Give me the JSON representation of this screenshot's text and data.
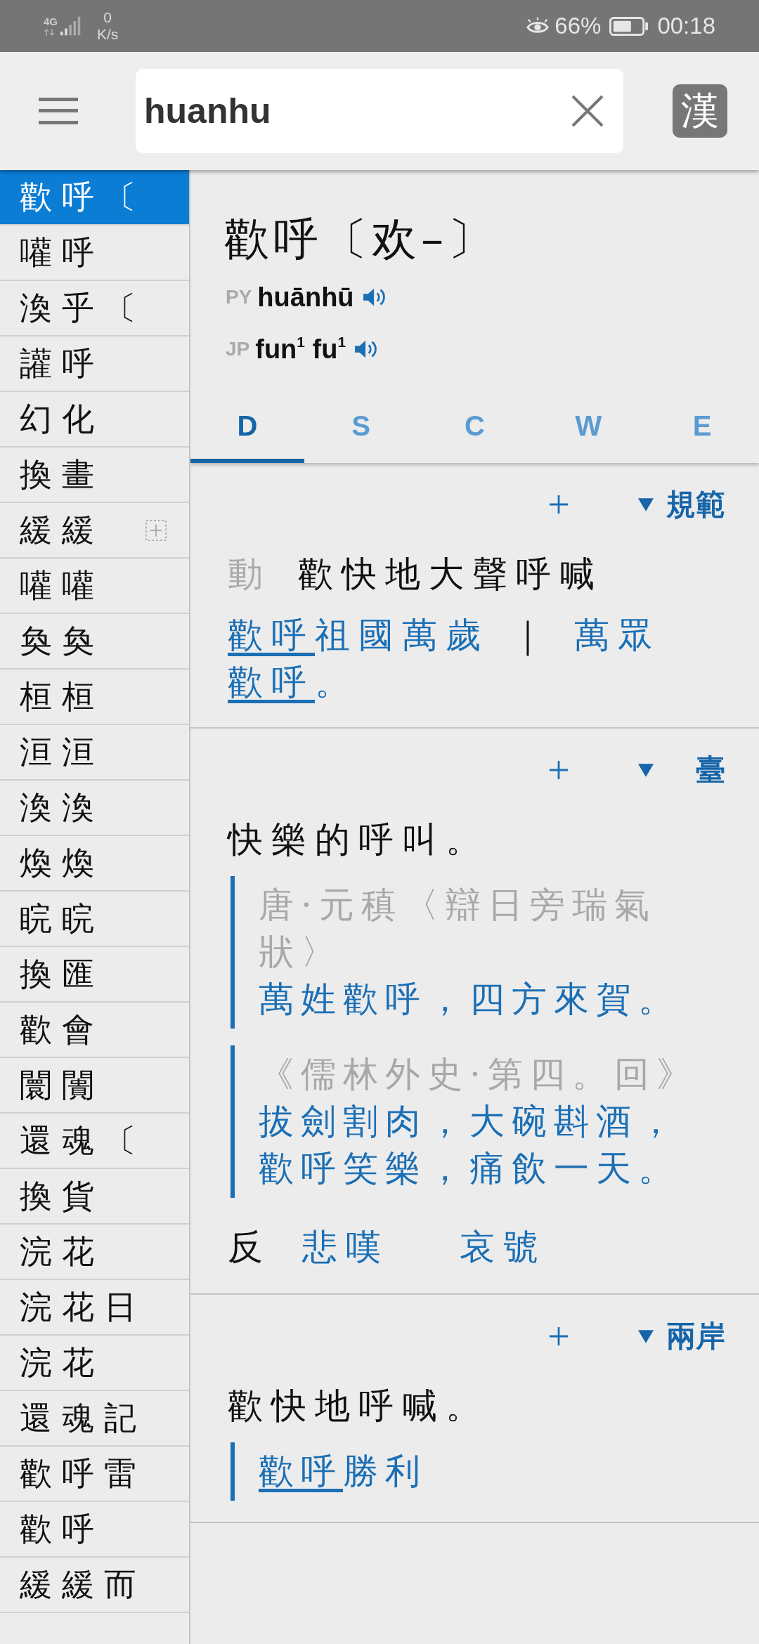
{
  "status_bar": {
    "network": "4G",
    "speed_value": "0",
    "speed_unit": "K/s",
    "battery": "66%",
    "time": "00:18"
  },
  "toolbar": {
    "search": {
      "value": "huanhu"
    },
    "script_button": "漢"
  },
  "word_list": [
    {
      "text": "歡呼〔",
      "selected": true,
      "expandable": false
    },
    {
      "text": "嚾呼",
      "selected": false,
      "expandable": false
    },
    {
      "text": "渙乎〔",
      "selected": false,
      "expandable": false
    },
    {
      "text": "讙呼",
      "selected": false,
      "expandable": false
    },
    {
      "text": "幻化",
      "selected": false,
      "expandable": false
    },
    {
      "text": "換畫",
      "selected": false,
      "expandable": false
    },
    {
      "text": "緩緩",
      "selected": false,
      "expandable": true
    },
    {
      "text": "嚾嚾",
      "selected": false,
      "expandable": false
    },
    {
      "text": "奐奐",
      "selected": false,
      "expandable": false
    },
    {
      "text": "桓桓",
      "selected": false,
      "expandable": false
    },
    {
      "text": "洹洹",
      "selected": false,
      "expandable": false
    },
    {
      "text": "渙渙",
      "selected": false,
      "expandable": false
    },
    {
      "text": "煥煥",
      "selected": false,
      "expandable": false
    },
    {
      "text": "睆睆",
      "selected": false,
      "expandable": false
    },
    {
      "text": "換匯",
      "selected": false,
      "expandable": false
    },
    {
      "text": "歡會",
      "selected": false,
      "expandable": false
    },
    {
      "text": "闤闠",
      "selected": false,
      "expandable": false
    },
    {
      "text": "還魂〔",
      "selected": false,
      "expandable": false
    },
    {
      "text": "換貨",
      "selected": false,
      "expandable": false
    },
    {
      "text": "浣花",
      "selected": false,
      "expandable": false
    },
    {
      "text": "浣花日",
      "selected": false,
      "expandable": false
    },
    {
      "text": "浣花",
      "selected": false,
      "expandable": false
    },
    {
      "text": "還魂記",
      "selected": false,
      "expandable": false
    },
    {
      "text": "歡呼雷",
      "selected": false,
      "expandable": false
    },
    {
      "text": "歡呼",
      "selected": false,
      "expandable": false
    },
    {
      "text": "緩緩而",
      "selected": false,
      "expandable": false
    }
  ],
  "entry": {
    "headword": "歡呼〔欢–〕",
    "readings": [
      {
        "label": "PY",
        "text": "huānhū"
      },
      {
        "label": "JP",
        "text": "fun$^{1}$ fu$^{1}$"
      }
    ],
    "tabs": [
      {
        "label": "D",
        "selected": true
      },
      {
        "label": "S",
        "selected": false
      },
      {
        "label": "C",
        "selected": false
      },
      {
        "label": "W",
        "selected": false
      },
      {
        "label": "E",
        "selected": false
      }
    ],
    "sections": [
      {
        "tag": "規範",
        "definitions": [
          {
            "pos": "動",
            "text": "歡快地大聲呼喊",
            "example": [
              {
                "kind": "link",
                "text": "歡呼"
              },
              {
                "kind": "text",
                "text": "祖國萬歲"
              },
              {
                "kind": "separator",
                "text": "｜"
              },
              {
                "kind": "text",
                "text": "萬眾"
              },
              {
                "kind": "link",
                "text": "歡呼"
              },
              {
                "kind": "text",
                "text": "。"
              }
            ]
          }
        ]
      },
      {
        "tag": "臺",
        "definitions": [
          {
            "text": "快樂的呼叫。",
            "quotes": [
              {
                "source": "唐·元稹〈辯日旁瑞氣狀〉",
                "segments": [
                  {
                    "kind": "text",
                    "text": "萬姓歡呼，四方來賀。"
                  }
                ]
              },
              {
                "source": "《儒林外史·第四。回》",
                "segments": [
                  {
                    "kind": "text",
                    "text": "拔劍割肉，大碗斟酒，歡呼笑樂，痛飲一天。"
                  }
                ]
              }
            ]
          }
        ],
        "antonyms": {
          "label": "反",
          "words": [
            "悲嘆",
            "哀號"
          ]
        }
      },
      {
        "tag": "兩岸",
        "definitions": [
          {
            "text": "歡快地呼喊。",
            "quotes": [
              {
                "segments": [
                  {
                    "kind": "link",
                    "text": "歡呼"
                  },
                  {
                    "kind": "text",
                    "text": "勝利"
                  }
                ]
              }
            ]
          }
        ]
      }
    ]
  }
}
